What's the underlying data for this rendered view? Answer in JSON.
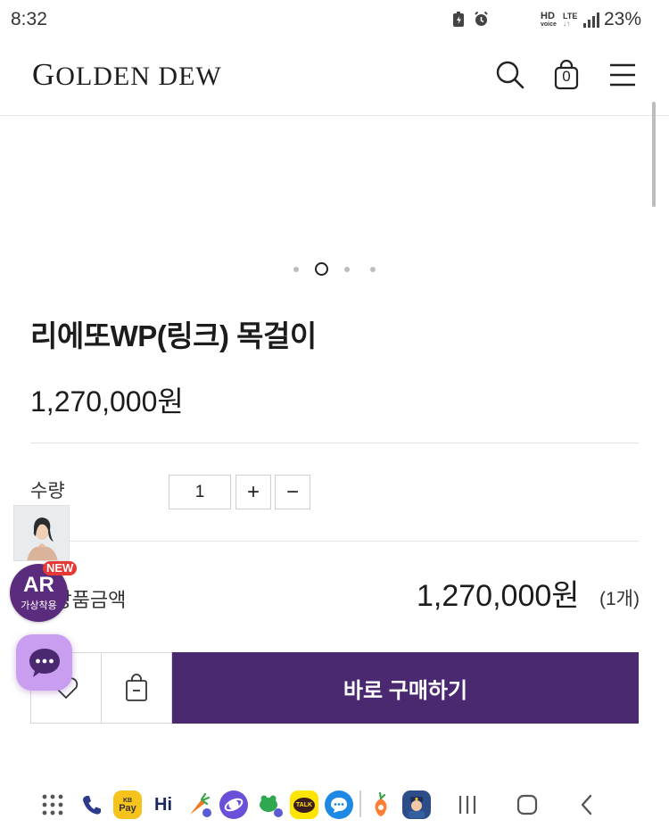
{
  "status_bar": {
    "time": "8:32",
    "hd_line1": "HD",
    "hd_line2": "voice",
    "lte": "LTE",
    "battery": "23%"
  },
  "header": {
    "logo_first": "G",
    "logo_rest": "OLDEN DEW",
    "icons": [
      "search-icon",
      "shopping-bag-icon",
      "menu-icon"
    ],
    "cart_count": "0"
  },
  "carousel": {
    "slide_count": 4,
    "active_index": 1
  },
  "product": {
    "name": "리에또WP(링크) 목걸이",
    "price": "1,270,000원"
  },
  "quantity": {
    "label": "수량",
    "value": "1",
    "plus": "+",
    "minus": "−"
  },
  "total": {
    "label": "총 상품금액",
    "price": "1,270,000원",
    "count": "(1개)"
  },
  "actions": {
    "buy_label": "바로 구매하기"
  },
  "ar_widget": {
    "big": "AR",
    "small": "가상착용",
    "new_badge": "NEW"
  },
  "nav_apps": [
    "apps-grid-icon",
    "phone-icon",
    "kbpay-icon",
    "hi-icon",
    "carrot-icon",
    "browser-icon",
    "frog-icon",
    "kakaotalk-icon",
    "messages-icon",
    "carrot-market-icon",
    "police-icon"
  ],
  "kb_label_top": "KB",
  "kb_label_bottom": "Pay",
  "hi_label": "Hi",
  "talk_label": "TALK",
  "theme": {
    "accent": "#4b2970",
    "ar_purple": "#5b2b7d",
    "chat_purple": "#c99ef0"
  }
}
